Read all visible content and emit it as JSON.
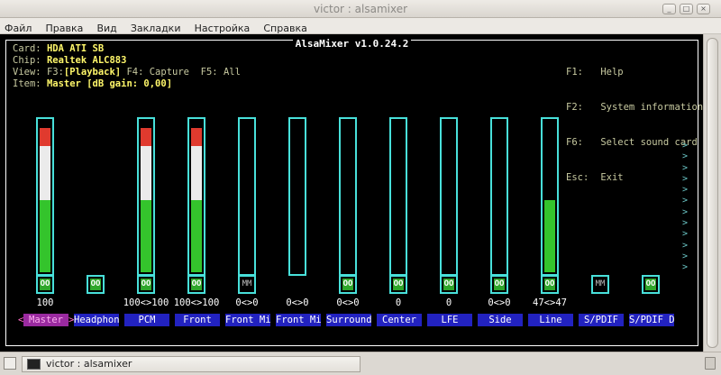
{
  "window": {
    "title": "victor : alsamixer",
    "controls": [
      "_",
      "□",
      "×"
    ]
  },
  "menu": [
    "Файл",
    "Правка",
    "Вид",
    "Закладки",
    "Настройка",
    "Справка"
  ],
  "mixer": {
    "title": "AlsaMixer v1.0.24.2",
    "card_label": "Card:",
    "card_value": "HDA ATI SB",
    "chip_label": "Chip:",
    "chip_value": "Realtek ALC883",
    "view_label": "View:",
    "view_f3": "F3:",
    "view_playback": "[Playback]",
    "view_f4": "F4: Capture",
    "view_f5": "F5: All",
    "item_label": "Item:",
    "item_value": "Master [dB gain: 0,00]",
    "help": [
      {
        "key": "F1:",
        "text": "Help"
      },
      {
        "key": "F2:",
        "text": "System information"
      },
      {
        "key": "F6:",
        "text": "Select sound card"
      },
      {
        "key": "Esc:",
        "text": "Exit"
      }
    ],
    "channels": [
      {
        "name": "Master",
        "volume": "100",
        "switch": "OO",
        "level_pct": 100,
        "selected": true
      },
      {
        "name": "Headphon",
        "volume": "",
        "switch": "OO",
        "level_pct": null
      },
      {
        "name": "PCM",
        "volume": "100<>100",
        "switch": "OO",
        "level_pct": 100
      },
      {
        "name": "Front",
        "volume": "100<>100",
        "switch": "OO",
        "level_pct": 100
      },
      {
        "name": "Front Mi",
        "volume": "0<>0",
        "switch": "MM",
        "level_pct": 0
      },
      {
        "name": "Front Mi",
        "volume": "0<>0",
        "switch": "",
        "level_pct": 0
      },
      {
        "name": "Surround",
        "volume": "0<>0",
        "switch": "OO",
        "level_pct": 0
      },
      {
        "name": "Center",
        "volume": "0",
        "switch": "OO",
        "level_pct": 0
      },
      {
        "name": "LFE",
        "volume": "0",
        "switch": "OO",
        "level_pct": 0
      },
      {
        "name": "Side",
        "volume": "0<>0",
        "switch": "OO",
        "level_pct": 0
      },
      {
        "name": "Line",
        "volume": "47<>47",
        "switch": "OO",
        "level_pct": 47
      },
      {
        "name": "S/PDIF",
        "volume": "",
        "switch": "MM",
        "level_pct": null
      },
      {
        "name": "S/PDIF D",
        "volume": "",
        "switch": "OO",
        "level_pct": null
      }
    ],
    "sel_left": "<",
    "sel_right": ">",
    "more_arrows": ">\n>\n>\n>\n>\n>\n>\n>\n>\n>\n>\n>"
  },
  "taskbar": {
    "task_label": "victor : alsamixer"
  },
  "colors": {
    "meter_border": "#48e0da",
    "level_red": "#e03a2e",
    "level_white": "#ebebeb",
    "level_green": "#34c42c",
    "name_bg": "#2222c0",
    "selected_bg": "#9a2aa0"
  }
}
